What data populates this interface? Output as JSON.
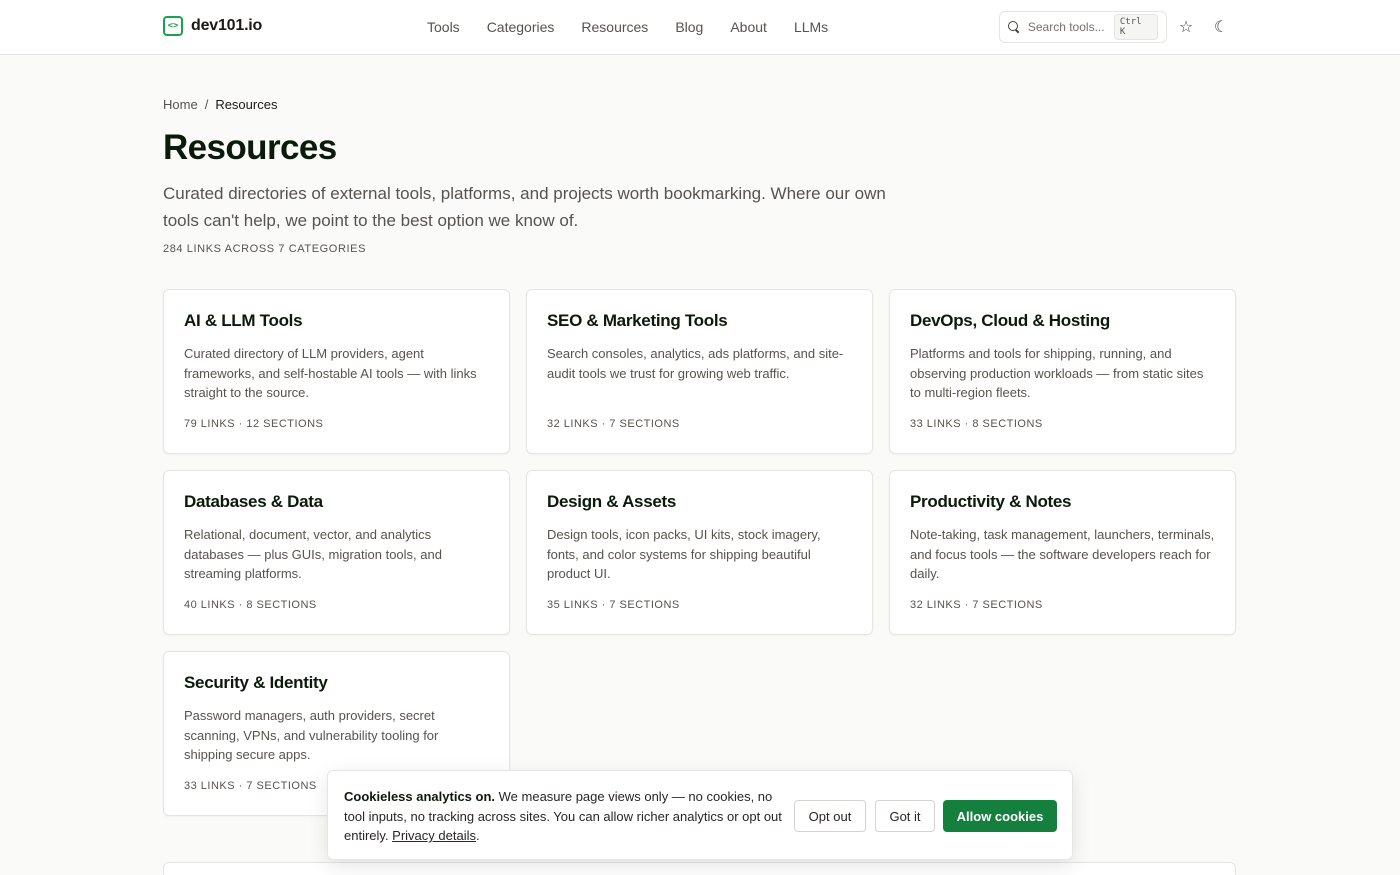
{
  "header": {
    "brand_mark": "<>",
    "brand": "dev101.io",
    "nav": [
      "Tools",
      "Categories",
      "Resources",
      "Blog",
      "About",
      "LLMs"
    ],
    "search_placeholder": "Search tools...",
    "search_shortcut": "Ctrl K",
    "star_icon": "☆",
    "moon_icon": "☾"
  },
  "breadcrumb": {
    "home": "Home",
    "sep": "/",
    "current": "Resources"
  },
  "page": {
    "title": "Resources",
    "intro": "Curated directories of external tools, platforms, and projects worth bookmarking. Where our own tools can't help, we point to the best option we know of.",
    "stats": "284 LINKS ACROSS 7 CATEGORIES"
  },
  "cards": [
    {
      "title": "AI & LLM Tools",
      "desc": "Curated directory of LLM providers, agent frameworks, and self-hostable AI tools — with links straight to the source.",
      "meta": "79 LINKS · 12 SECTIONS"
    },
    {
      "title": "SEO & Marketing Tools",
      "desc": "Search consoles, analytics, ads platforms, and site-audit tools we trust for growing web traffic.",
      "meta": "32 LINKS · 7 SECTIONS"
    },
    {
      "title": "DevOps, Cloud & Hosting",
      "desc": "Platforms and tools for shipping, running, and observing production workloads — from static sites to multi-region fleets.",
      "meta": "33 LINKS · 8 SECTIONS"
    },
    {
      "title": "Databases & Data",
      "desc": "Relational, document, vector, and analytics databases — plus GUIs, migration tools, and streaming platforms.",
      "meta": "40 LINKS · 8 SECTIONS"
    },
    {
      "title": "Design & Assets",
      "desc": "Design tools, icon packs, UI kits, stock imagery, fonts, and color systems for shipping beautiful product UI.",
      "meta": "35 LINKS · 7 SECTIONS"
    },
    {
      "title": "Productivity & Notes",
      "desc": "Note-taking, task management, launchers, terminals, and focus tools — the software developers reach for daily.",
      "meta": "32 LINKS · 7 SECTIONS"
    },
    {
      "title": "Security & Identity",
      "desc": "Password managers, auth providers, secret scanning, VPNs, and vulnerability tooling for shipping secure apps.",
      "meta": "33 LINKS · 7 SECTIONS"
    }
  ],
  "cookie": {
    "lead": "Cookieless analytics on.",
    "body": " We measure page views only — no cookies, no tool inputs, no tracking across sites. You can allow richer analytics or opt out entirely. ",
    "link": "Privacy details",
    "tail": ".",
    "opt_out": "Opt out",
    "got_it": "Got it",
    "allow": "Allow cookies"
  },
  "colors": {
    "accent": "#15803d",
    "brand_icon": "#16a34a",
    "background": "#fafaf9"
  }
}
